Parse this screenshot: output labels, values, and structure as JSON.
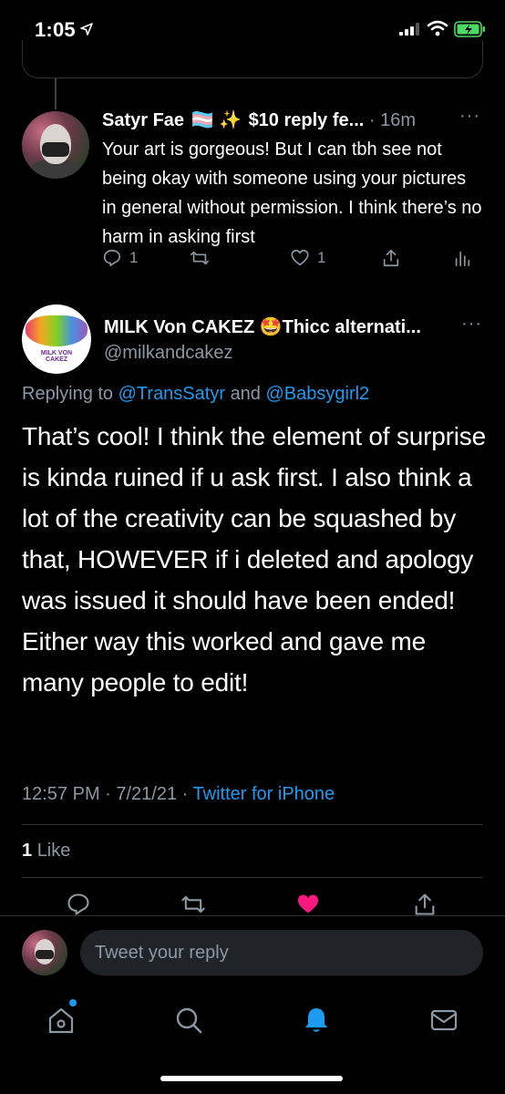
{
  "status_bar": {
    "time": "1:05",
    "battery_color": "#4cd964"
  },
  "reply_tweet": {
    "display_name": "Satyr Fae",
    "name_emojis": "🏳️‍⚧️ ✨",
    "name_suffix": "$10 reply fe...",
    "time": "· 16m",
    "more": "···",
    "text": "Your art is gorgeous! But I can tbh see not being okay with someone using your pictures in general without permission. I think there’s no harm in asking first",
    "reply_count": "1",
    "like_count": "1"
  },
  "main_tweet": {
    "avatar_text": "MILK VON CAKEZ",
    "display_name": "MILK Von CAKEZ 🤩Thicc alternati...",
    "more": "···",
    "handle": "@milkandcakez",
    "replying_prefix": "Replying to",
    "mention_1": "@TransSatyr",
    "replying_and": "and",
    "mention_2": "@Babsygirl2",
    "text": "That’s cool! I think the element of surprise is kinda ruined if u ask first. I also think a lot of the creativity can be squashed by that, HOWEVER if i deleted and apology was issued it should have been ended! Either way this worked and gave me many people to edit!",
    "timestamp": "12:57 PM · 7/21/21 ·",
    "client": "Twitter for iPhone",
    "like_count": "1",
    "like_label": "Like",
    "like_color": "#f91880"
  },
  "reply_bar": {
    "placeholder": "Tweet your reply"
  },
  "tabbar": {
    "items": [
      "home-icon",
      "search-icon",
      "notifications-icon",
      "messages-icon"
    ],
    "active": "notifications-icon",
    "accent": "#1d9bf0"
  }
}
